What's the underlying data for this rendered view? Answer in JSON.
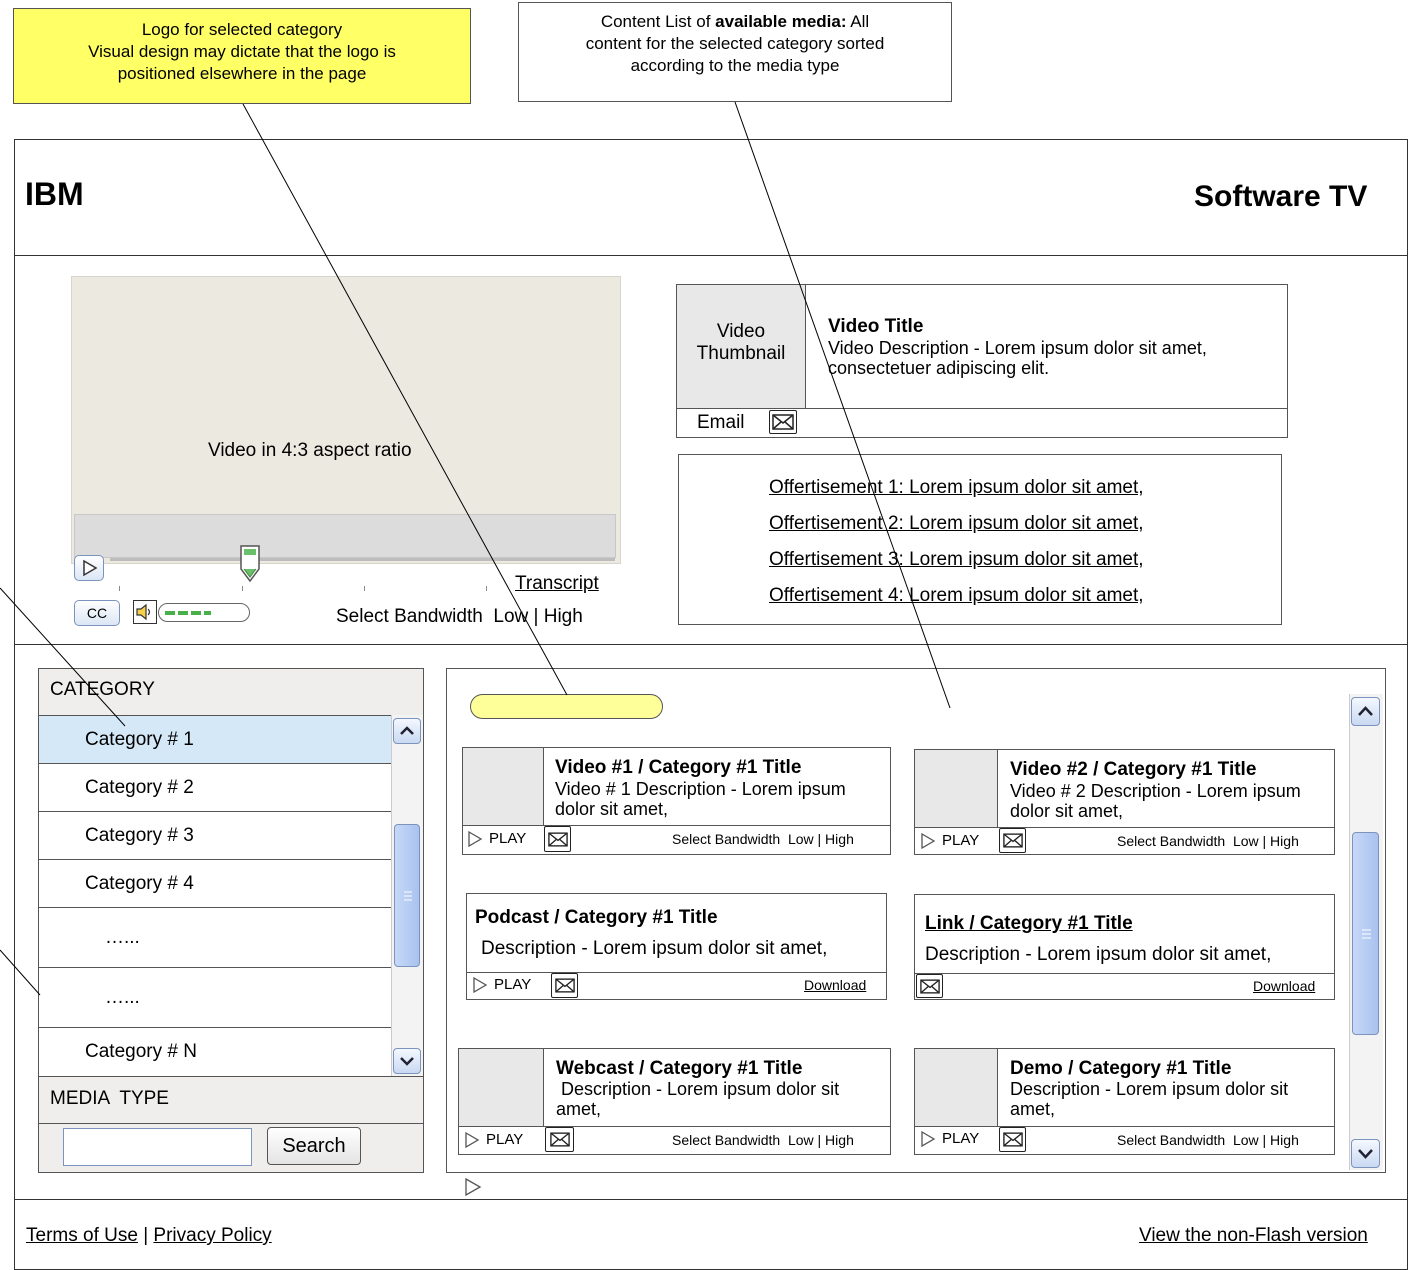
{
  "annotations": {
    "logo_note": {
      "line1": "Logo for selected category",
      "line2": "Visual design may dictate that the logo is",
      "line3": "positioned elsewhere in the page",
      "bg": "#ffff66"
    },
    "content_note": {
      "line1_pre": "Content List of ",
      "line1_bold": "available media:",
      "line1_post": " All",
      "line2": "content for the selected category sorted",
      "line3": "according to the media type"
    }
  },
  "header": {
    "logo": "IBM",
    "title": "Software TV"
  },
  "player": {
    "video_label": "Video in 4:3 aspect ratio",
    "transcript_link": "Transcript",
    "cc_label": "CC",
    "bandwidth_label": "Select Bandwidth  Low | High",
    "bg_color": "#ece9e1"
  },
  "video_info": {
    "thumb_line1": "Video",
    "thumb_line2": "Thumbnail",
    "title": "Video Title",
    "description": "Video Description - Lorem ipsum dolor sit amet, consectetuer adipiscing elit.",
    "email_label": "Email"
  },
  "offers": [
    "Offertisement 1: Lorem ipsum dolor sit amet,",
    "Offertisement 2: Lorem ipsum dolor sit amet,",
    "Offertisement 3: Lorem ipsum dolor sit amet,",
    "Offertisement 4: Lorem ipsum dolor sit amet,"
  ],
  "sidebar": {
    "category_header": "CATEGORY",
    "items": [
      "Category # 1",
      "Category # 2",
      "Category # 3",
      "Category # 4",
      "…...",
      "…...",
      "Category # N"
    ],
    "selected_color": "#d5e8f8",
    "media_type_header": "MEDIA  TYPE",
    "search_button": "Search",
    "search_value": ""
  },
  "content": {
    "logo_placeholder_color": "#ffff99",
    "cards": [
      {
        "title": "Video #1  / Category #1 Title",
        "desc": "Video # 1 Description - Lorem ipsum dolor sit amet,",
        "play": "PLAY",
        "right": "Select Bandwidth  Low | High"
      },
      {
        "title": "Video #2 / Category #1 Title",
        "desc": "Video # 2 Description - Lorem ipsum dolor sit amet,",
        "play": "PLAY",
        "right": "Select Bandwidth  Low | High"
      },
      {
        "title": "Podcast / Category #1 Title",
        "desc": "Description - Lorem ipsum dolor sit amet,",
        "play": "PLAY",
        "right": "Download"
      },
      {
        "title": "Link / Category #1  Title",
        "desc": "Description - Lorem ipsum dolor sit amet,",
        "right": "Download"
      },
      {
        "title": "Webcast / Category #1 Title",
        "desc": " Description - Lorem ipsum dolor sit amet,",
        "play": "PLAY",
        "right": "Select Bandwidth  Low | High"
      },
      {
        "title": "Demo / Category #1  Title",
        "desc": "Description - Lorem ipsum dolor sit amet,",
        "play": "PLAY",
        "right": "Select Bandwidth  Low | High"
      }
    ]
  },
  "footer": {
    "terms": "Terms of Use",
    "separator": "|",
    "privacy": "Privacy Policy",
    "non_flash": "View the non-Flash version"
  }
}
